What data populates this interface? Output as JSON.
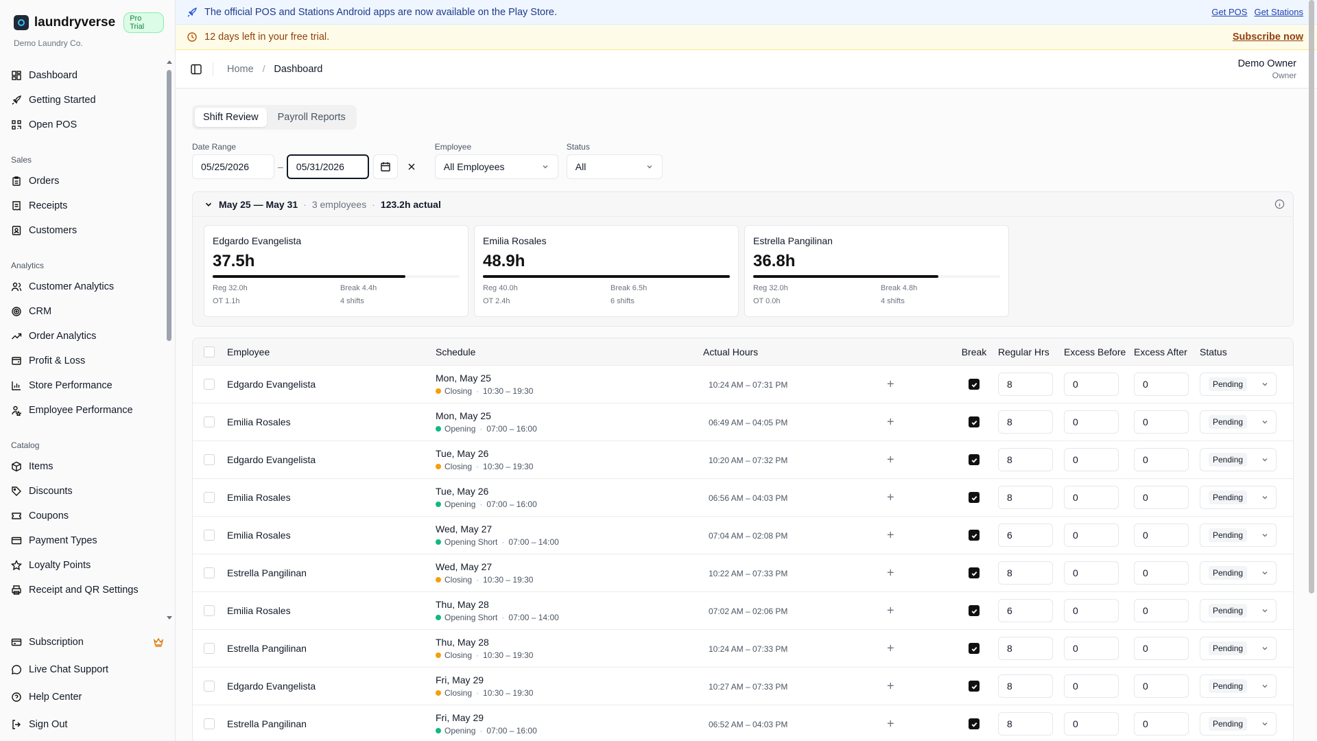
{
  "brand": {
    "name": "laundryverse",
    "badge": "Pro Trial",
    "org": "Demo Laundry Co."
  },
  "nav": {
    "top": [
      {
        "label": "Dashboard",
        "icon": "dashboard-icon"
      },
      {
        "label": "Getting Started",
        "icon": "rocket-icon"
      },
      {
        "label": "Open POS",
        "icon": "qr-icon"
      }
    ],
    "sales_title": "Sales",
    "sales": [
      {
        "label": "Orders",
        "icon": "clipboard-icon"
      },
      {
        "label": "Receipts",
        "icon": "receipt-icon"
      },
      {
        "label": "Customers",
        "icon": "contact-icon"
      }
    ],
    "analytics_title": "Analytics",
    "analytics": [
      {
        "label": "Customer Analytics",
        "icon": "users-icon"
      },
      {
        "label": "CRM",
        "icon": "target-icon"
      },
      {
        "label": "Order Analytics",
        "icon": "trend-icon"
      },
      {
        "label": "Profit & Loss",
        "icon": "wallet-icon"
      },
      {
        "label": "Store Performance",
        "icon": "bar-chart-icon"
      },
      {
        "label": "Employee Performance",
        "icon": "user-star-icon"
      }
    ],
    "catalog_title": "Catalog",
    "catalog": [
      {
        "label": "Items",
        "icon": "package-icon"
      },
      {
        "label": "Discounts",
        "icon": "tag-icon"
      },
      {
        "label": "Coupons",
        "icon": "ticket-icon"
      },
      {
        "label": "Payment Types",
        "icon": "credit-card-icon"
      },
      {
        "label": "Loyalty Points",
        "icon": "star-icon"
      },
      {
        "label": "Receipt and QR Settings",
        "icon": "printer-icon"
      }
    ],
    "bottom": [
      {
        "label": "Subscription",
        "icon": "card-icon"
      },
      {
        "label": "Live Chat Support",
        "icon": "chat-icon"
      },
      {
        "label": "Help Center",
        "icon": "help-icon"
      },
      {
        "label": "Sign Out",
        "icon": "logout-icon"
      }
    ]
  },
  "announce": {
    "text": "The official POS and Stations Android apps are now available on the Play Store.",
    "get_pos": "Get POS",
    "get_stations": "Get Stations"
  },
  "trial": {
    "text": "12 days left in your free trial.",
    "cta": "Subscribe now"
  },
  "breadcrumb": {
    "home": "Home",
    "current": "Dashboard"
  },
  "user": {
    "name": "Demo Owner",
    "role": "Owner"
  },
  "tabs": [
    "Shift Review",
    "Payroll Reports"
  ],
  "filters": {
    "date_label": "Date Range",
    "date_from": "05/25/2026",
    "date_to": "05/31/2026",
    "employee_label": "Employee",
    "employee_value": "All Employees",
    "status_label": "Status",
    "status_value": "All"
  },
  "summary": {
    "range": "May 25 — May 31",
    "employees": "3 employees",
    "actual": "123.2h actual",
    "cards": [
      {
        "name": "Edgardo Evangelista",
        "hours": "37.5h",
        "fill": 0.78,
        "reg": "Reg 32.0h",
        "break": "Break 4.4h",
        "ot": "OT 1.1h",
        "shifts": "4 shifts"
      },
      {
        "name": "Emilia Rosales",
        "hours": "48.9h",
        "fill": 1.0,
        "reg": "Reg 40.0h",
        "break": "Break 6.5h",
        "ot": "OT 2.4h",
        "shifts": "6 shifts"
      },
      {
        "name": "Estrella Pangilinan",
        "hours": "36.8h",
        "fill": 0.75,
        "reg": "Reg 32.0h",
        "break": "Break 4.8h",
        "ot": "OT 0.0h",
        "shifts": "4 shifts"
      }
    ]
  },
  "table": {
    "headers": {
      "employee": "Employee",
      "schedule": "Schedule",
      "actual": "Actual Hours",
      "break": "Break",
      "regular": "Regular Hrs",
      "excess_before": "Excess Before",
      "excess_after": "Excess After",
      "status": "Status"
    },
    "rows": [
      {
        "employee": "Edgardo Evangelista",
        "day": "Mon, May 25",
        "shift": "Closing",
        "shift_color": "#f59e0b",
        "time": "10:30 – 19:30",
        "actual": "10:24 AM – 07:31 PM",
        "regular": "8",
        "exb": "0",
        "exa": "0",
        "status": "Pending"
      },
      {
        "employee": "Emilia Rosales",
        "day": "Mon, May 25",
        "shift": "Opening",
        "shift_color": "#10b981",
        "time": "07:00 – 16:00",
        "actual": "06:49 AM – 04:05 PM",
        "regular": "8",
        "exb": "0",
        "exa": "0",
        "status": "Pending"
      },
      {
        "employee": "Edgardo Evangelista",
        "day": "Tue, May 26",
        "shift": "Closing",
        "shift_color": "#f59e0b",
        "time": "10:30 – 19:30",
        "actual": "10:20 AM – 07:32 PM",
        "regular": "8",
        "exb": "0",
        "exa": "0",
        "status": "Pending"
      },
      {
        "employee": "Emilia Rosales",
        "day": "Tue, May 26",
        "shift": "Opening",
        "shift_color": "#10b981",
        "time": "07:00 – 16:00",
        "actual": "06:56 AM – 04:03 PM",
        "regular": "8",
        "exb": "0",
        "exa": "0",
        "status": "Pending"
      },
      {
        "employee": "Emilia Rosales",
        "day": "Wed, May 27",
        "shift": "Opening Short",
        "shift_color": "#10b981",
        "time": "07:00 – 14:00",
        "actual": "07:04 AM – 02:08 PM",
        "regular": "6",
        "exb": "0",
        "exa": "0",
        "status": "Pending"
      },
      {
        "employee": "Estrella Pangilinan",
        "day": "Wed, May 27",
        "shift": "Closing",
        "shift_color": "#f59e0b",
        "time": "10:30 – 19:30",
        "actual": "10:22 AM – 07:33 PM",
        "regular": "8",
        "exb": "0",
        "exa": "0",
        "status": "Pending"
      },
      {
        "employee": "Emilia Rosales",
        "day": "Thu, May 28",
        "shift": "Opening Short",
        "shift_color": "#10b981",
        "time": "07:00 – 14:00",
        "actual": "07:02 AM – 02:06 PM",
        "regular": "6",
        "exb": "0",
        "exa": "0",
        "status": "Pending"
      },
      {
        "employee": "Estrella Pangilinan",
        "day": "Thu, May 28",
        "shift": "Closing",
        "shift_color": "#f59e0b",
        "time": "10:30 – 19:30",
        "actual": "10:24 AM – 07:33 PM",
        "regular": "8",
        "exb": "0",
        "exa": "0",
        "status": "Pending"
      },
      {
        "employee": "Edgardo Evangelista",
        "day": "Fri, May 29",
        "shift": "Closing",
        "shift_color": "#f59e0b",
        "time": "10:30 – 19:30",
        "actual": "10:27 AM – 07:33 PM",
        "regular": "8",
        "exb": "0",
        "exa": "0",
        "status": "Pending"
      },
      {
        "employee": "Estrella Pangilinan",
        "day": "Fri, May 29",
        "shift": "Opening",
        "shift_color": "#10b981",
        "time": "07:00 – 16:00",
        "actual": "06:52 AM – 04:03 PM",
        "regular": "8",
        "exb": "0",
        "exa": "0",
        "status": "Pending"
      }
    ]
  }
}
